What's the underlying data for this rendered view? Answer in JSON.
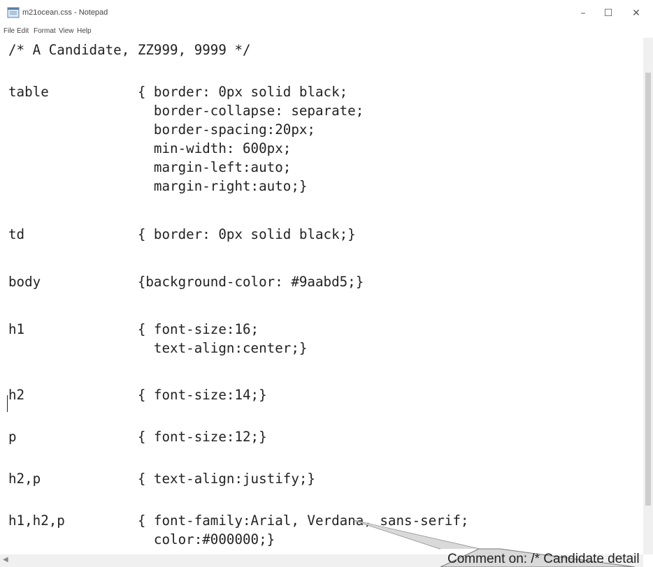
{
  "window": {
    "title": "m21ocean.css - Notepad",
    "controls": {
      "minimize": "–",
      "maximize": "☐",
      "close": "✕"
    }
  },
  "menu": [
    "File",
    "Edit",
    "Format",
    "View",
    "Help"
  ],
  "editor": {
    "lines": [
      "/* A Candidate, ZZ999, 9999 */",
      "",
      "table           { border: 0px solid black;",
      "                  border-collapse: separate;",
      "                  border-spacing:20px;",
      "                  min-width: 600px;",
      "                  margin-left:auto;",
      "                  margin-right:auto;}",
      "",
      "td              { border: 0px solid black;}",
      "",
      "body            {background-color: #9aabd5;}",
      "",
      "h1              { font-size:16;",
      "                  text-align:center;}",
      "",
      "h2              { font-size:14;}",
      "",
      "p               { font-size:12;}",
      "",
      "h2,p            { text-align:justify;}",
      "",
      "h1,h2,p         { font-family:Arial, Verdana, sans-serif;",
      "                  color:#000000;}"
    ]
  },
  "callout": {
    "text": "Comment on: /* Candidate detail"
  }
}
